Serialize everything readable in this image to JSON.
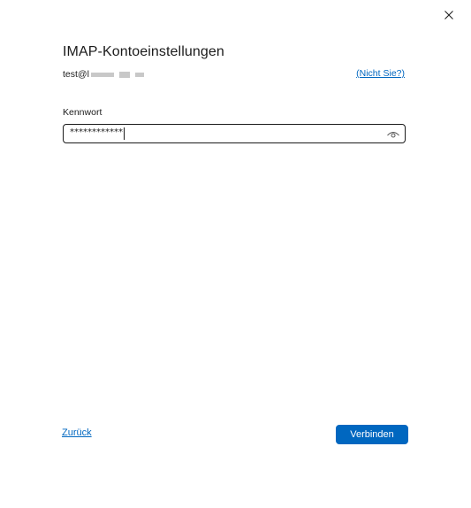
{
  "dialog": {
    "close_icon": "close-icon",
    "title": "IMAP-Kontoeinstellungen",
    "account": {
      "email_prefix": "test@l",
      "not_you_link": "(Nicht Sie?)"
    },
    "password": {
      "label": "Kennwort",
      "value": "************",
      "reveal_icon": "eye-icon"
    },
    "footer": {
      "back_link": "Zurück",
      "connect_button": "Verbinden"
    }
  },
  "colors": {
    "accent": "#0067c0",
    "text": "#1b1b1b",
    "background": "#ffffff"
  }
}
